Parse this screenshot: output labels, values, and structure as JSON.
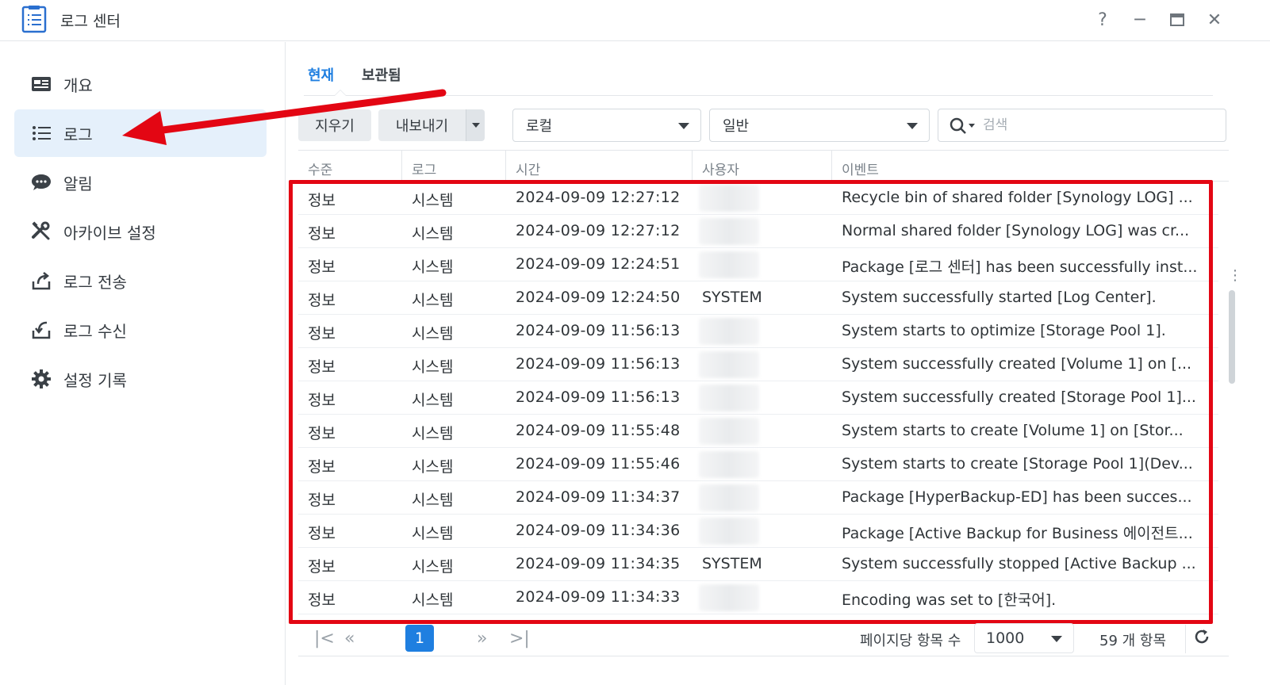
{
  "window": {
    "title": "로그 센터",
    "help": "?",
    "minimize": "─",
    "maximize": "▭",
    "close": "✕"
  },
  "sidebar": {
    "items": [
      {
        "label": "개요",
        "icon": "dashboard-icon"
      },
      {
        "label": "로그",
        "icon": "list-icon",
        "active": true
      },
      {
        "label": "알림",
        "icon": "chat-bubble-icon"
      },
      {
        "label": "아카이브 설정",
        "icon": "tools-icon"
      },
      {
        "label": "로그 전송",
        "icon": "upload-icon"
      },
      {
        "label": "로그 수신",
        "icon": "download-icon"
      },
      {
        "label": "설정 기록",
        "icon": "gear-icon"
      }
    ]
  },
  "tabs": [
    {
      "label": "현재",
      "active": true
    },
    {
      "label": "보관됨",
      "active": false
    }
  ],
  "toolbar": {
    "clear_label": "지우기",
    "export_label": "내보내기",
    "source_select": "로컬",
    "level_select": "일반",
    "search_placeholder": "검색"
  },
  "table": {
    "headers": [
      "수준",
      "로그",
      "시간",
      "사용자",
      "이벤트"
    ],
    "rows": [
      {
        "level": "정보",
        "log": "시스템",
        "time": "2024-09-09 12:27:12",
        "user": "",
        "event": "Recycle bin of shared folder [Synology LOG] ..."
      },
      {
        "level": "정보",
        "log": "시스템",
        "time": "2024-09-09 12:27:12",
        "user": "",
        "event": "Normal shared folder [Synology LOG] was cr..."
      },
      {
        "level": "정보",
        "log": "시스템",
        "time": "2024-09-09 12:24:51",
        "user": "",
        "event": "Package [로그 센터] has been successfully inst..."
      },
      {
        "level": "정보",
        "log": "시스템",
        "time": "2024-09-09 12:24:50",
        "user": "SYSTEM",
        "event": "System successfully started [Log Center]."
      },
      {
        "level": "정보",
        "log": "시스템",
        "time": "2024-09-09 11:56:13",
        "user": "",
        "event": "System starts to optimize [Storage Pool 1]."
      },
      {
        "level": "정보",
        "log": "시스템",
        "time": "2024-09-09 11:56:13",
        "user": "",
        "event": "System successfully created [Volume 1] on [..."
      },
      {
        "level": "정보",
        "log": "시스템",
        "time": "2024-09-09 11:56:13",
        "user": "",
        "event": "System successfully created [Storage Pool 1]..."
      },
      {
        "level": "정보",
        "log": "시스템",
        "time": "2024-09-09 11:55:48",
        "user": "",
        "event": "System starts to create [Volume 1] on [Stor..."
      },
      {
        "level": "정보",
        "log": "시스템",
        "time": "2024-09-09 11:55:46",
        "user": "",
        "event": "System starts to create [Storage Pool 1](Dev..."
      },
      {
        "level": "정보",
        "log": "시스템",
        "time": "2024-09-09 11:34:37",
        "user": "",
        "event": "Package [HyperBackup-ED] has been succes..."
      },
      {
        "level": "정보",
        "log": "시스템",
        "time": "2024-09-09 11:34:36",
        "user": "",
        "event": "Package [Active Backup for Business 에이전트..."
      },
      {
        "level": "정보",
        "log": "시스템",
        "time": "2024-09-09 11:34:35",
        "user": "SYSTEM",
        "event": "System successfully stopped [Active Backup ..."
      },
      {
        "level": "정보",
        "log": "시스템",
        "time": "2024-09-09 11:34:33",
        "user": "",
        "event": "Encoding was set to [한국어]."
      }
    ]
  },
  "pager": {
    "current_page": "1",
    "per_page_label": "페이지당 항목 수",
    "per_page_value": "1000",
    "total_label": "59 개 항목"
  },
  "colors": {
    "accent": "#1f7fe0",
    "highlight": "#e30613",
    "sidebar_active": "#e5f0fb"
  }
}
